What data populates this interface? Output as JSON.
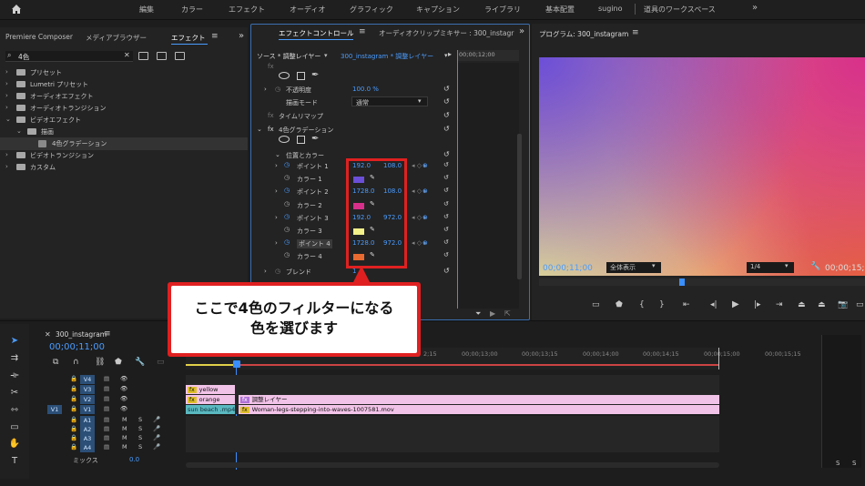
{
  "menu": {
    "workspaces": [
      "編集",
      "カラー",
      "エフェクト",
      "オーディオ",
      "グラフィック",
      "キャプション",
      "ライブラリ",
      "基本配置"
    ],
    "active_user": "sugino",
    "tools_workspace": "道具のワークスペース",
    "more": "»"
  },
  "project_panel": {
    "tabs": [
      "Premiere Composer",
      "メディアブラウザー",
      "エフェクト"
    ],
    "search_value": "4色",
    "tree": [
      {
        "label": "プリセット",
        "expanded": false,
        "indent": 0
      },
      {
        "label": "Lumetri プリセット",
        "expanded": false,
        "indent": 0
      },
      {
        "label": "オーディオエフェクト",
        "expanded": false,
        "indent": 0
      },
      {
        "label": "オーディオトランジション",
        "expanded": false,
        "indent": 0
      },
      {
        "label": "ビデオエフェクト",
        "expanded": true,
        "indent": 0
      },
      {
        "label": "描画",
        "expanded": true,
        "indent": 1
      },
      {
        "label": "4色グラデーション",
        "expanded": false,
        "indent": 2,
        "selected": true
      },
      {
        "label": "ビデオトランジション",
        "expanded": false,
        "indent": 0
      },
      {
        "label": "カスタム",
        "expanded": false,
        "indent": 0
      }
    ]
  },
  "effect_controls": {
    "tabs": [
      "エフェクトコントロール",
      "オーディオクリップミキサー : 300_instagr"
    ],
    "source": "ソース * 調整レイヤー",
    "sequence": "300_instagram * 調整レイヤー",
    "timecode": "00;00;12;00",
    "opacity_label": "不透明度",
    "opacity_value": "100.0 %",
    "blend_label": "描画モード",
    "blend_value": "通常",
    "time_remap": "タイムリマップ",
    "effect_name": "4色グラデーション",
    "group_label": "位置とカラー",
    "rows": [
      {
        "kind": "point",
        "label": "ポイント 1",
        "x": "192.0",
        "y": "108.0"
      },
      {
        "kind": "color",
        "label": "カラー 1",
        "color": "#6b4fd8"
      },
      {
        "kind": "point",
        "label": "ポイント 2",
        "x": "1728.0",
        "y": "108.0"
      },
      {
        "kind": "color",
        "label": "カラー 2",
        "color": "#d8308a"
      },
      {
        "kind": "point",
        "label": "ポイント 3",
        "x": "192.0",
        "y": "972.0"
      },
      {
        "kind": "color",
        "label": "カラー 3",
        "color": "#f4f08a"
      },
      {
        "kind": "point",
        "label": "ポイント 4",
        "x": "1728.0",
        "y": "972.0"
      },
      {
        "kind": "color",
        "label": "カラー 4",
        "color": "#e86a30"
      }
    ],
    "blend_row": "ブレンド",
    "blend_row_value": "1"
  },
  "program": {
    "title": "プログラム: 300_instagram",
    "timecode": "00;00;11;00",
    "fit": "全体表示",
    "resolution": "1/4",
    "end_timecode": "00;00;15;"
  },
  "timeline": {
    "tab": "300_instagram",
    "timecode": "00;00;11;00",
    "ruler": [
      "2;15",
      "00;00;13;00",
      "00;00;13;15",
      "00;00;14;00",
      "00;00;14;15",
      "00;00;15;00",
      "00;00;15;15"
    ],
    "video_tracks": [
      "V4",
      "V3",
      "V2",
      "V1"
    ],
    "audio_tracks": [
      "A1",
      "A2",
      "A3",
      "A4"
    ],
    "source_patch": "V1",
    "mix_label": "ミックス",
    "mix_value": "0.0",
    "clips": {
      "yellow": "yellow",
      "orange": "orange",
      "adjust": "調整レイヤー",
      "sun": "sun beach .mp4",
      "woman": "Woman-legs-stepping-into-waves-1007581.mov"
    }
  },
  "meter": {
    "solo_labels": [
      "S",
      "S"
    ]
  },
  "callout": {
    "line1": "ここで4色のフィルターになる",
    "line2": "色を選びます"
  },
  "colors": {
    "accent": "#4a9cff",
    "highlight": "#e02020",
    "clip_pink": "#f2c3e8",
    "clip_teal": "#5ab8c0"
  }
}
